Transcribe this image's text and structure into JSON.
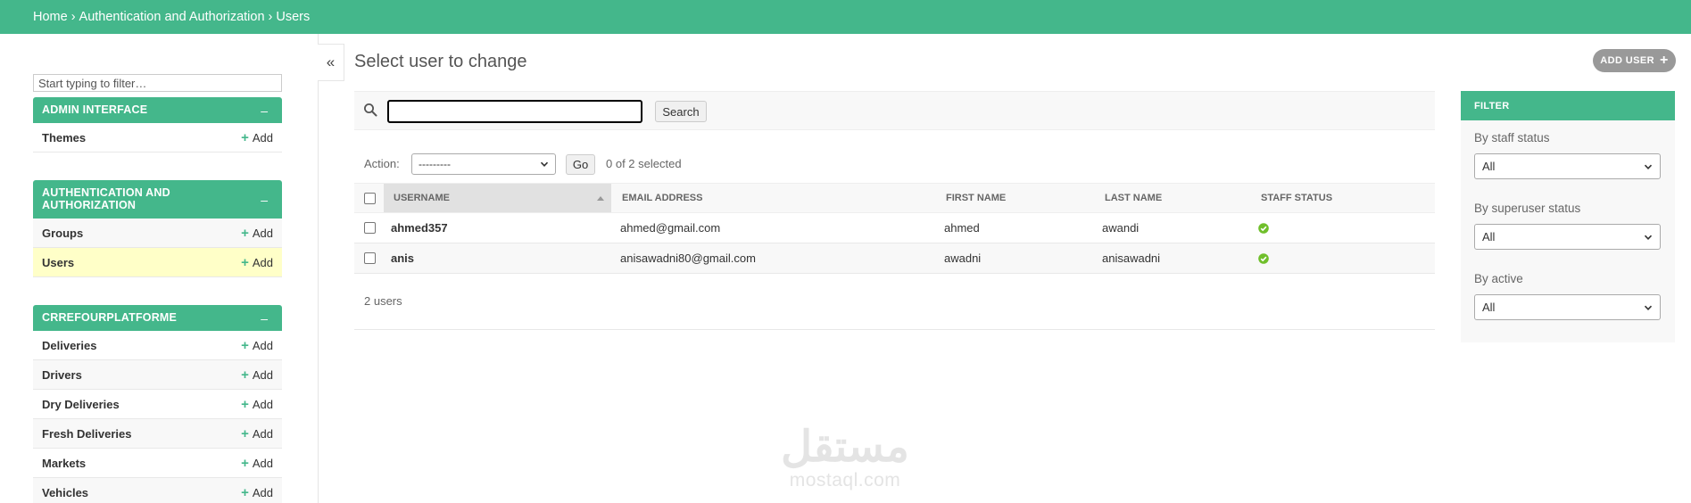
{
  "breadcrumbs": {
    "home": "Home",
    "section": "Authentication and Authorization",
    "current": "Users",
    "separator": "›"
  },
  "sidebar": {
    "filter_placeholder": "Start typing to filter…",
    "collapse_symbol": "–",
    "toggle_symbol": "«",
    "add_label": "Add",
    "modules": [
      {
        "caption": "Admin Interface",
        "models": [
          "Themes"
        ]
      },
      {
        "caption": "Authentication and Authorization",
        "models": [
          "Groups",
          "Users"
        ],
        "current": "Users"
      },
      {
        "caption": "Crrefourplatforme",
        "models": [
          "Deliveries",
          "Drivers",
          "Dry Deliveries",
          "Fresh Deliveries",
          "Markets",
          "Vehicles"
        ]
      }
    ]
  },
  "main": {
    "title": "Select user to change",
    "add_button": "Add user",
    "search_button": "Search",
    "search_value": "",
    "action_label": "Action:",
    "action_selected": "---------",
    "go_button": "Go",
    "selected_text": "0 of 2 selected",
    "columns": [
      "Username",
      "Email address",
      "First name",
      "Last name",
      "Staff status"
    ],
    "rows": [
      {
        "username": "ahmed357",
        "email": "ahmed@gmail.com",
        "first_name": "ahmed",
        "last_name": "awandi",
        "staff": true
      },
      {
        "username": "anis",
        "email": "anisawadni80@gmail.com",
        "first_name": "awadni",
        "last_name": "anisawadni",
        "staff": true
      }
    ],
    "paginator": "2 users"
  },
  "filter": {
    "title": "Filter",
    "groups": [
      {
        "label": "By staff status",
        "selected": "All"
      },
      {
        "label": "By superuser status",
        "selected": "All"
      },
      {
        "label": "By active",
        "selected": "All"
      }
    ]
  },
  "watermark": {
    "arabic": "مستقل",
    "latin": "mostaql.com"
  },
  "colors": {
    "accent": "#44b78b",
    "current_row": "#ffffc8",
    "staff_true": "#70bf2b",
    "add_button_bg": "#999999"
  }
}
